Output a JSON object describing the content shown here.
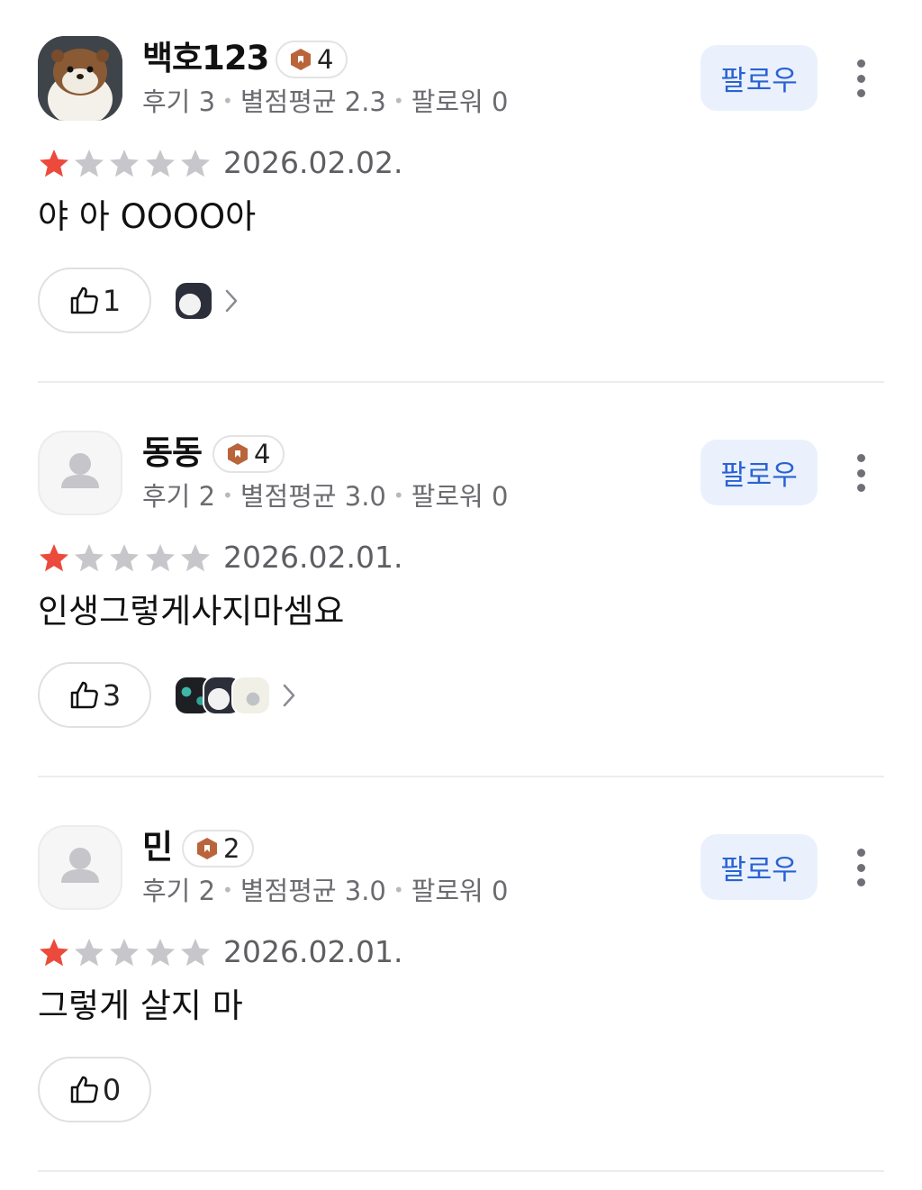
{
  "reviews": [
    {
      "username": "백호123",
      "level": "4",
      "reviews_label": "후기 3",
      "rating_avg_label": "별점평균 2.3",
      "followers_label": "팔로워 0",
      "follow_label": "팔로우",
      "rating": 1,
      "max_rating": 5,
      "date": "2026.02.02.",
      "content": "야 아 OOOO아",
      "likes": "1",
      "thumbnail_count": 1,
      "avatar": "otter-plush-photo"
    },
    {
      "username": "동동",
      "level": "4",
      "reviews_label": "후기 2",
      "rating_avg_label": "별점평균 3.0",
      "followers_label": "팔로워 0",
      "follow_label": "팔로우",
      "rating": 1,
      "max_rating": 5,
      "date": "2026.02.01.",
      "content": "인생그렇게사지마셈요",
      "likes": "3",
      "thumbnail_count": 3,
      "avatar": "default-person-icon"
    },
    {
      "username": "민",
      "level": "2",
      "reviews_label": "후기 2",
      "rating_avg_label": "별점평균 3.0",
      "followers_label": "팔로워 0",
      "follow_label": "팔로우",
      "rating": 1,
      "max_rating": 5,
      "date": "2026.02.01.",
      "content": "그렇게 살지 마",
      "likes": "0",
      "thumbnail_count": 0,
      "avatar": "default-person-icon"
    }
  ],
  "colors": {
    "star_filled": "#ec4a3c",
    "star_empty": "#c7c7cb",
    "follow_text": "#2a62d4",
    "follow_bg": "#eaf1fd",
    "badge_icon": "#b9643a"
  }
}
